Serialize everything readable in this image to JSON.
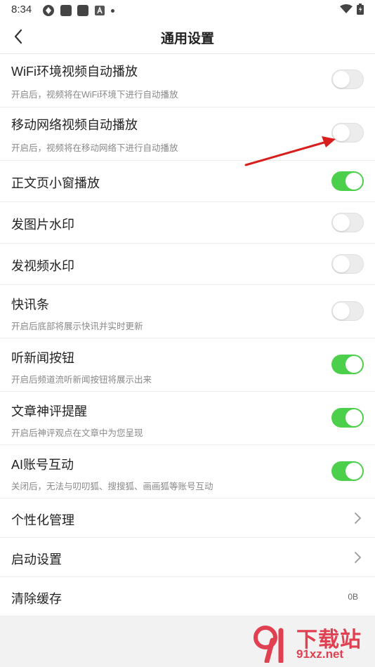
{
  "status_bar": {
    "time": "8:34"
  },
  "header": {
    "title": "通用设置"
  },
  "settings": [
    {
      "label": "WiFi环境视频自动播放",
      "sub": "开启后，视频将在WiFi环境下进行自动播放",
      "toggle": false
    },
    {
      "label": "移动网络视频自动播放",
      "sub": "开启后，视频将在移动网络下进行自动播放",
      "toggle": false
    },
    {
      "label": "正文页小窗播放",
      "toggle": true
    },
    {
      "label": "发图片水印",
      "toggle": false
    },
    {
      "label": "发视频水印",
      "toggle": false
    },
    {
      "label": "快讯条",
      "sub": "开启后底部将展示快讯并实时更新",
      "toggle": false
    },
    {
      "label": "听新闻按钮",
      "sub": "开启后频道流听新闻按钮将展示出来",
      "toggle": true
    },
    {
      "label": "文章神评提醒",
      "sub": "开启后神评观点在文章中为您呈现",
      "toggle": true
    },
    {
      "label": "AI账号互动",
      "sub": "关闭后，无法与叨叨狐、搜搜狐、画画狐等账号互动",
      "toggle": true
    }
  ],
  "links": [
    {
      "label": "个性化管理"
    },
    {
      "label": "启动设置"
    },
    {
      "label": "清除缓存",
      "value": "0B"
    }
  ],
  "watermark": {
    "brand": "下载站",
    "url": "91xz.net"
  },
  "colors": {
    "toggle_on": "#4cd04c",
    "toggle_off": "#ececec",
    "annotation_arrow": "#d91e1e"
  }
}
